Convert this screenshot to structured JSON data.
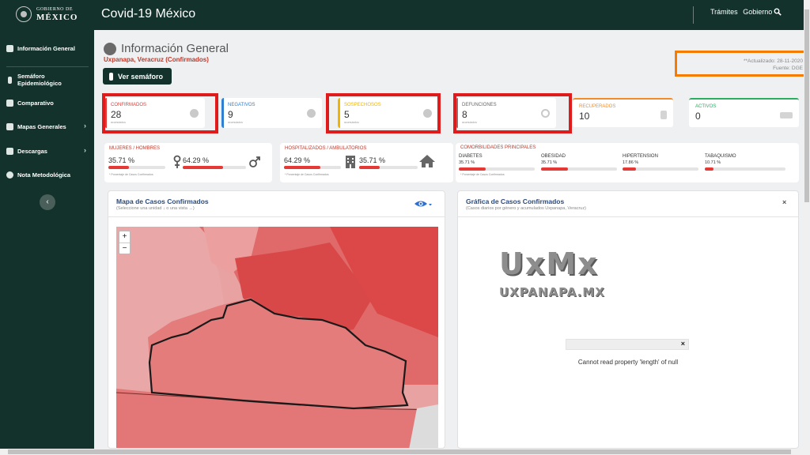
{
  "header": {
    "logo_line1": "GOBIERNO DE",
    "logo_line2": "MÉXICO",
    "title": "Covid-19 México",
    "links": [
      "Trámites",
      "Gobierno"
    ]
  },
  "sidebar": {
    "items": [
      {
        "label": "Información General",
        "icon": "gauge-icon"
      },
      {
        "label": "Semáforo Epidemiológico",
        "icon": "traffic-light-icon"
      },
      {
        "label": "Comparativo",
        "icon": "people-icon"
      },
      {
        "label": "Mapas Generales",
        "icon": "monitor-icon",
        "chevron": "›"
      },
      {
        "label": "Descargas",
        "icon": "download-icon",
        "chevron": "›"
      },
      {
        "label": "Nota Metodológica",
        "icon": "info-icon"
      }
    ],
    "collapse_label": "‹"
  },
  "page": {
    "title": "Información General",
    "subtitle": "Uxpanapa, Veracruz (Confirmados)",
    "semaforo_button": "Ver semáforo",
    "updated": "**Actualizado: 28-11-2020",
    "source": "Fuente: DGE"
  },
  "cards": [
    {
      "label": "CONFIRMADOS",
      "value": "28",
      "sub": "acumulados",
      "color": "#e53935"
    },
    {
      "label": "NEGATIVOS",
      "value": "9",
      "sub": "acumulados",
      "color": "#2f80d1"
    },
    {
      "label": "SOSPECHOSOS",
      "value": "5",
      "sub": "acumulados",
      "color": "#f0b400"
    },
    {
      "label": "DEFUNCIONES",
      "value": "8",
      "sub": "acumulados",
      "color": "#7a7a7a"
    },
    {
      "label": "RECUPERADOS",
      "value": "10",
      "color": "#f28c28"
    },
    {
      "label": "ACTIVOS",
      "value": "0",
      "color": "#27ae60"
    }
  ],
  "gender": {
    "title": "MUJERES / HOMBRES",
    "women_pct": "35.71 %",
    "men_pct": "64.29 %",
    "women_fill": 0.3571,
    "men_fill": 0.6429,
    "note": "* Porcentaje de Casos Confirmados"
  },
  "hospital": {
    "title": "HOSPITALIZADOS / AMBULATORIOS",
    "hosp_pct": "64.29 %",
    "amb_pct": "35.71 %",
    "hosp_fill": 0.6429,
    "amb_fill": 0.3571,
    "note": "* Porcentaje de Casos Confirmados"
  },
  "comorbidities": {
    "title": "COMORBILIDADES PRINCIPALES",
    "items": [
      {
        "label": "DIABETES",
        "value": "35.71 %",
        "fill": 0.3571
      },
      {
        "label": "OBESIDAD",
        "value": "35.71 %",
        "fill": 0.3571
      },
      {
        "label": "HIPERTENSION",
        "value": "17.86 %",
        "fill": 0.1786
      },
      {
        "label": "TABAQUISMO",
        "value": "10.71 %",
        "fill": 0.1071
      }
    ],
    "note": "* Porcentaje de Casos Confirmados"
  },
  "map_panel": {
    "title": "Mapa de Casos Confirmados",
    "subtitle": "(Seleccione una unidad ↓ o una vista →)",
    "zoom_in": "+",
    "zoom_out": "−"
  },
  "chart_panel": {
    "title": "Gráfica de Casos Confirmados",
    "subtitle": "(Casos diarios por género y acumulados Uxpanapa, Veracruz)",
    "close": "×",
    "watermark_big": "UxMx",
    "watermark_small": "UXPANAPA.MX",
    "error_close": "×",
    "error_message": "Cannot read property 'length' of null"
  }
}
